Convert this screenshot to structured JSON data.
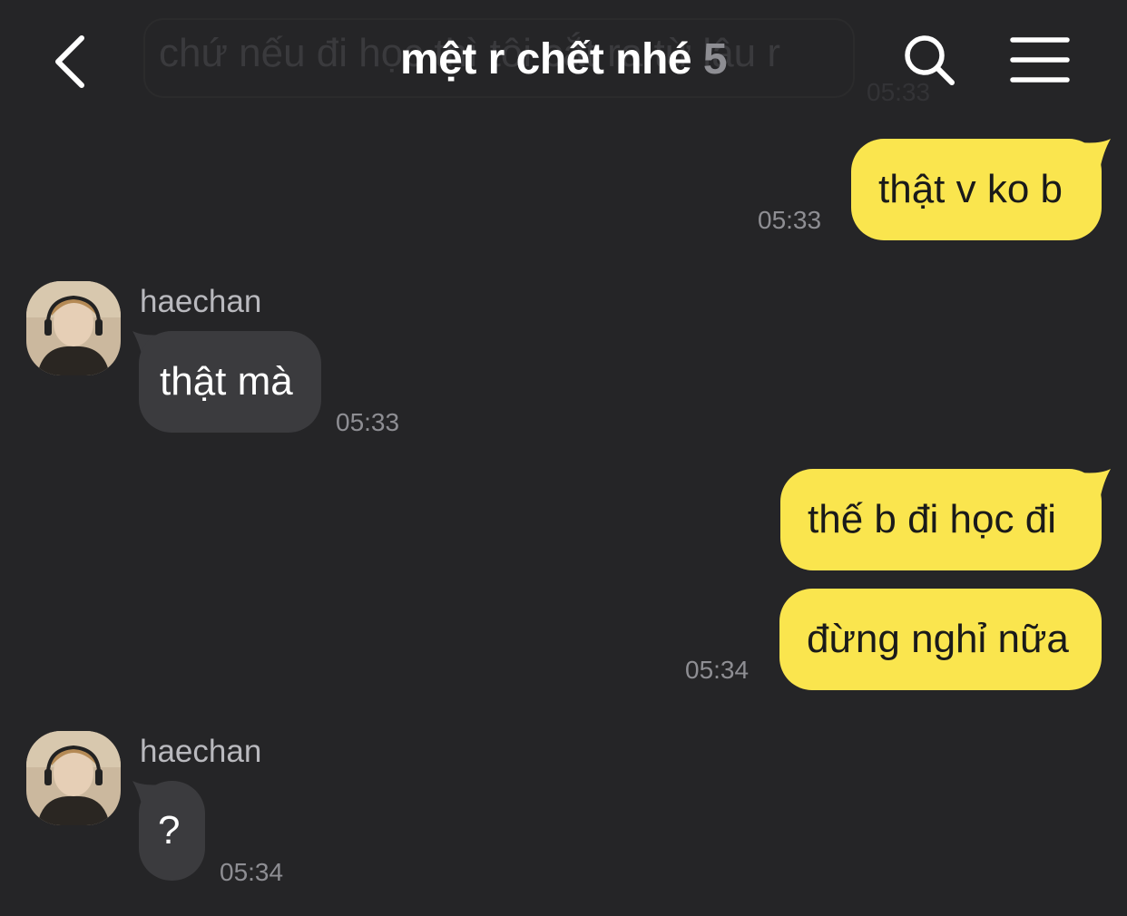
{
  "header": {
    "title": "mệt r chết nhé",
    "member_count": "5",
    "ghost_message": "chứ nếu đi học thì tôi cắt ra từ lâu r",
    "ghost_time": "05:33"
  },
  "messages": [
    {
      "direction": "out",
      "text": "thật v ko b",
      "time": "05:33"
    },
    {
      "direction": "in",
      "sender": "haechan",
      "text": "thật mà",
      "time": "05:33"
    },
    {
      "direction": "out",
      "text": "thế b đi học đi"
    },
    {
      "direction": "out",
      "text": "đừng nghỉ nữa",
      "time": "05:34"
    },
    {
      "direction": "in",
      "sender": "haechan",
      "text": "?",
      "time": "05:34"
    }
  ],
  "colors": {
    "background": "#252527",
    "outgoing_bubble": "#fae54e",
    "incoming_bubble": "#3b3b3e",
    "timestamp": "#8e8e93"
  },
  "icons": [
    "back-arrow-icon",
    "search-icon",
    "menu-icon",
    "avatar-photo"
  ]
}
